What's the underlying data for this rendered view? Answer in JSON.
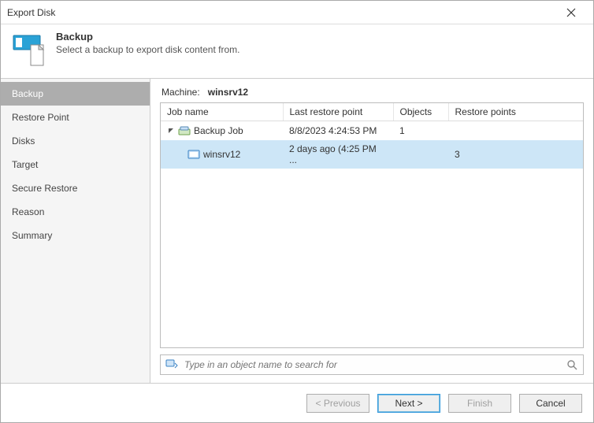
{
  "window": {
    "title": "Export Disk"
  },
  "header": {
    "title": "Backup",
    "subtitle": "Select a backup to export disk content from."
  },
  "sidebar": {
    "items": [
      {
        "label": "Backup",
        "active": true
      },
      {
        "label": "Restore Point"
      },
      {
        "label": "Disks"
      },
      {
        "label": "Target"
      },
      {
        "label": "Secure Restore"
      },
      {
        "label": "Reason"
      },
      {
        "label": "Summary"
      }
    ]
  },
  "machine": {
    "label": "Machine:",
    "name": "winsrv12"
  },
  "table": {
    "columns": [
      "Job name",
      "Last restore point",
      "Objects",
      "Restore points"
    ],
    "rows": [
      {
        "name": "Backup Job",
        "last": "8/8/2023 4:24:53 PM",
        "objects": "1",
        "restore": "",
        "depth": 0,
        "kind": "job"
      },
      {
        "name": "winsrv12",
        "last": "2 days ago (4:25 PM ...",
        "objects": "",
        "restore": "3",
        "depth": 1,
        "kind": "vm",
        "selected": true
      }
    ]
  },
  "search": {
    "placeholder": "Type in an object name to search for"
  },
  "footer": {
    "previous": "< Previous",
    "next": "Next >",
    "finish": "Finish",
    "cancel": "Cancel"
  }
}
